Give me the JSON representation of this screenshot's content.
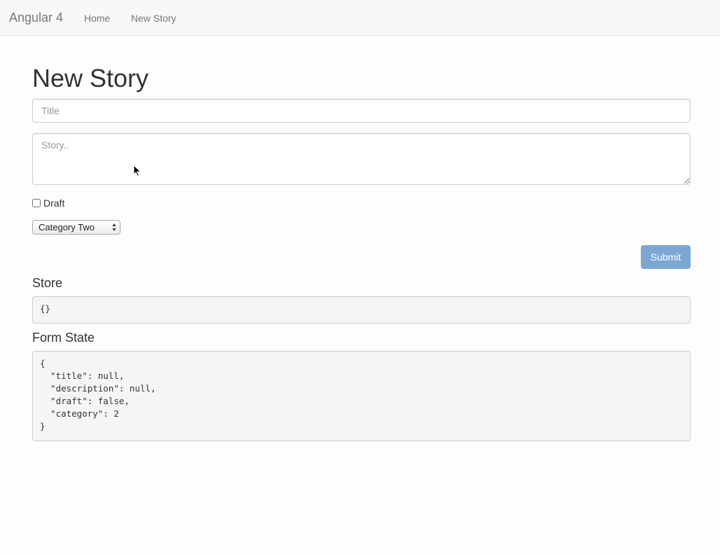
{
  "navbar": {
    "brand": "Angular 4",
    "links": [
      {
        "label": "Home"
      },
      {
        "label": "New Story"
      }
    ]
  },
  "page": {
    "title": "New Story"
  },
  "form": {
    "title_placeholder": "Title",
    "title_value": "",
    "story_placeholder": "Story..",
    "story_value": "",
    "draft_label": "Draft",
    "draft_checked": false,
    "category_selected": "Category Two",
    "submit_label": "Submit"
  },
  "store": {
    "heading": "Store",
    "content": "{}"
  },
  "form_state": {
    "heading": "Form State",
    "content": "{\n  \"title\": null,\n  \"description\": null,\n  \"draft\": false,\n  \"category\": 2\n}"
  },
  "colors": {
    "submit_background": "#7ca7d2",
    "navbar_background": "#f8f8f8",
    "code_background": "#f5f5f5"
  },
  "icons": {
    "cursor": "mouse-pointer-icon",
    "select_arrows": "up-down-arrows-icon"
  }
}
